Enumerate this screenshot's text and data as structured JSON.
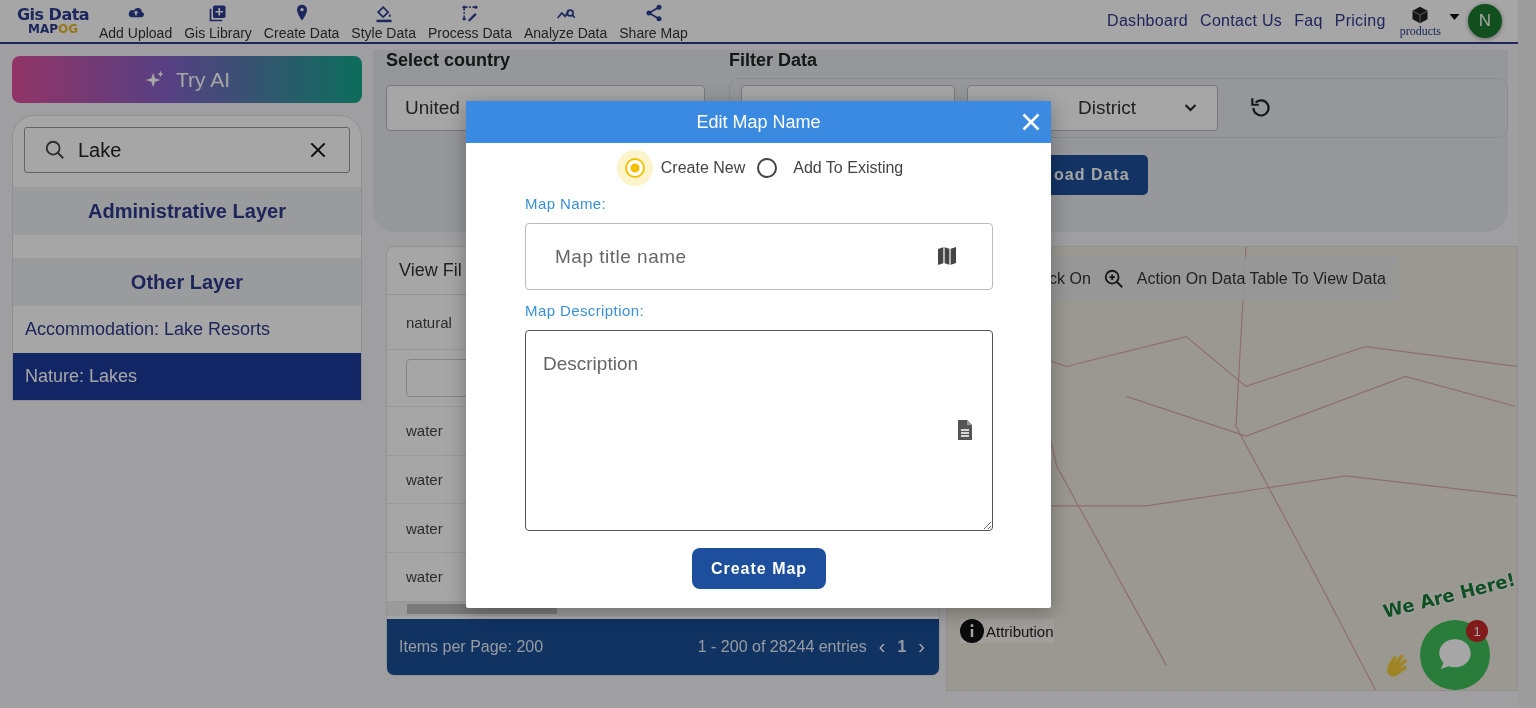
{
  "header": {
    "logo_top": "Gis Data",
    "logo_bottom": [
      "MAP",
      "OG"
    ],
    "nav": [
      {
        "kind": "upload",
        "label": "Add Upload"
      },
      {
        "kind": "library",
        "label": "Gis Library"
      },
      {
        "kind": "pin",
        "label": "Create Data"
      },
      {
        "kind": "style",
        "label": "Style Data"
      },
      {
        "kind": "process",
        "label": "Process Data"
      },
      {
        "kind": "analyze",
        "label": "Analyze Data"
      },
      {
        "kind": "share",
        "label": "Share Map"
      }
    ],
    "links": [
      "Dashboard",
      "Contact Us",
      "Faq",
      "Pricing"
    ],
    "products": "products",
    "avatar": "N"
  },
  "sidebar": {
    "try_ai": "Try AI",
    "search_value": "Lake",
    "sections": [
      {
        "title": "Administrative Layer"
      },
      {
        "title": "Other Layer",
        "items": [
          {
            "label": "Accommodation: Lake Resorts",
            "selected": false
          },
          {
            "label": "Nature: Lakes",
            "selected": true
          }
        ]
      }
    ]
  },
  "filters": {
    "country_label": "Select country",
    "country_value": "United",
    "filter_label": "Filter Data",
    "district_value": "District",
    "download_button": "oad Data"
  },
  "table": {
    "header": "View Fil",
    "rows": [
      {
        "kind": "text",
        "value": "natural"
      },
      {
        "kind": "filter"
      },
      {
        "kind": "text",
        "value": "water"
      },
      {
        "kind": "text",
        "value": "water"
      },
      {
        "kind": "text",
        "value": "water"
      },
      {
        "kind": "text",
        "value": "water"
      }
    ],
    "items_per_page": "Items per Page: 200",
    "entries": "1 - 200 of 28244 entries",
    "prev": "‹",
    "page": "1",
    "next": "›"
  },
  "map": {
    "hint_start": "ck On",
    "hint": "Action On Data Table To View Data",
    "attribution": "Attribution"
  },
  "chat": {
    "greeting": "We Are Here!",
    "badge": "1"
  },
  "modal": {
    "title": "Edit Map Name",
    "options": [
      {
        "label": "Create New",
        "selected": true
      },
      {
        "label": "Add To Existing",
        "selected": false
      }
    ],
    "name_label": "Map Name:",
    "name_placeholder": "Map title name",
    "description_label": "Map Description:",
    "description_placeholder": "Description",
    "submit": "Create Map"
  }
}
